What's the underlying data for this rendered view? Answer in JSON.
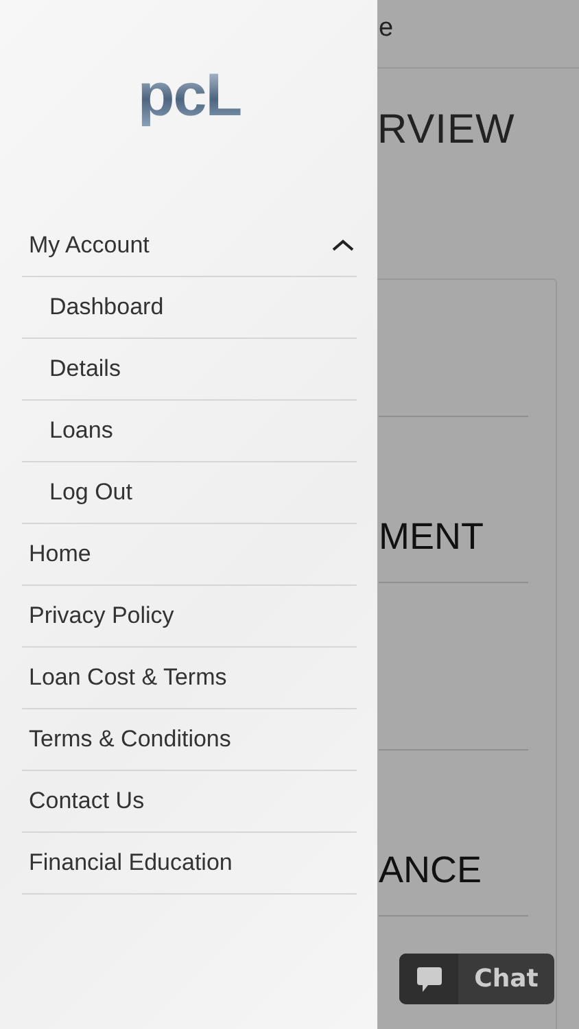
{
  "drawer": {
    "logo": "pcL",
    "menu": [
      {
        "label": "My Account",
        "expanded": true,
        "children": [
          {
            "label": "Dashboard"
          },
          {
            "label": "Details"
          },
          {
            "label": "Loans"
          },
          {
            "label": "Log Out"
          }
        ]
      },
      {
        "label": "Home"
      },
      {
        "label": "Privacy Policy"
      },
      {
        "label": "Loan Cost & Terms"
      },
      {
        "label": "Terms & Conditions"
      },
      {
        "label": "Contact Us"
      },
      {
        "label": "Financial Education"
      }
    ]
  },
  "page": {
    "header_title": "e",
    "title": "RVIEW",
    "sections": [
      "MENT",
      "ANCE"
    ],
    "chat_button": "Chat"
  }
}
